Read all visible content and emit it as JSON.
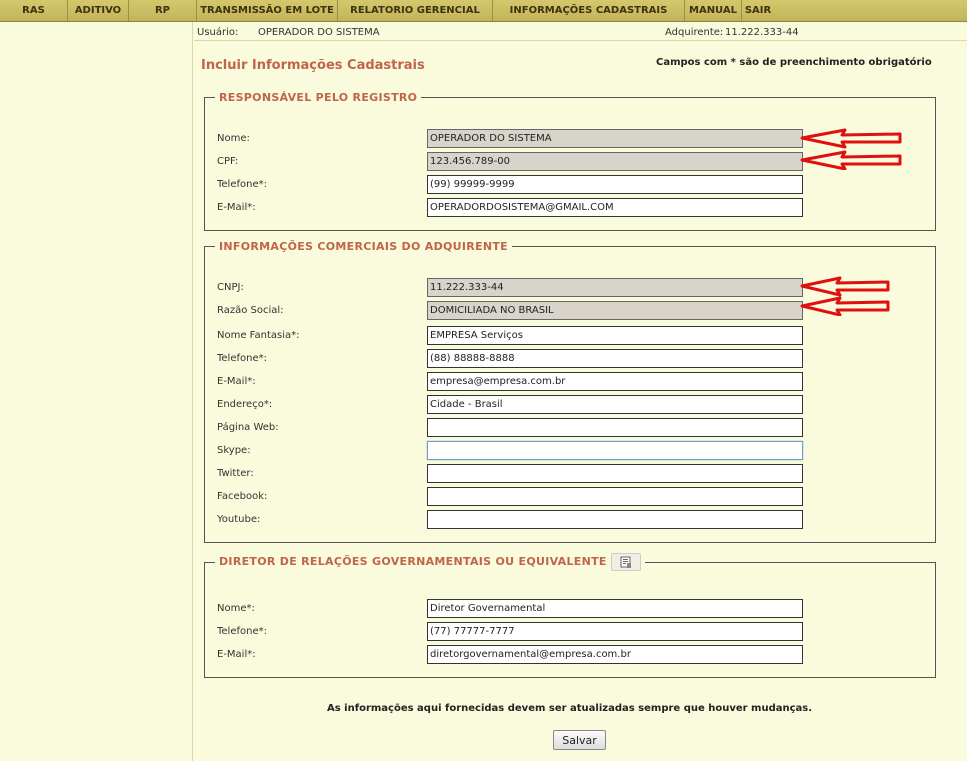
{
  "menu": [
    {
      "label": "RAS"
    },
    {
      "label": "ADITIVO"
    },
    {
      "label": "RP"
    },
    {
      "label": "TRANSMISSÃO EM LOTE"
    },
    {
      "label": "RELATORIO GERENCIAL"
    },
    {
      "label": "INFORMAÇÕES CADASTRAIS"
    },
    {
      "label": "MANUAL"
    },
    {
      "label": "SAIR"
    }
  ],
  "infobar": {
    "user_label": "Usuário:",
    "user_value": "OPERADOR DO SISTEMA",
    "acquirer_label": "Adquirente:",
    "acquirer_value": "11.222.333-44"
  },
  "page": {
    "title": "Incluir Informações Cadastrais",
    "required_note": "Campos com * são de preenchimento obrigatório",
    "footer_note": "As informações aqui fornecidas devem ser atualizadas sempre que houver mudanças.",
    "save_label": "Salvar"
  },
  "responsavel": {
    "legend": "RESPONSÁVEL PELO REGISTRO",
    "fields": [
      {
        "label": "Nome:",
        "value": "OPERADOR DO SISTEMA",
        "readonly": true
      },
      {
        "label": "CPF:",
        "value": "123.456.789-00",
        "readonly": true
      },
      {
        "label": "Telefone*:",
        "value": "(99) 99999-9999",
        "readonly": false
      },
      {
        "label": "E-Mail*:",
        "value": "OPERADORDOSISTEMA@GMAIL.COM",
        "readonly": false
      }
    ]
  },
  "comerciais": {
    "legend": "INFORMAÇÕES COMERCIAIS DO ADQUIRENTE",
    "fields": [
      {
        "label": "CNPJ:",
        "value": "11.222.333-44",
        "readonly": true
      },
      {
        "label": "Razão Social:",
        "value": "DOMICILIADA NO BRASIL",
        "readonly": true
      },
      {
        "label": "Nome Fantasia*:",
        "value": "EMPRESA Serviços",
        "readonly": false
      },
      {
        "label": "Telefone*:",
        "value": "(88) 88888-8888",
        "readonly": false
      },
      {
        "label": "E-Mail*:",
        "value": "empresa@empresa.com.br",
        "readonly": false
      },
      {
        "label": "Endereço*:",
        "value": "Cidade - Brasil",
        "readonly": false
      },
      {
        "label": "Página Web:",
        "value": "",
        "readonly": false
      },
      {
        "label": "Skype:",
        "value": "",
        "readonly": false
      },
      {
        "label": "Twitter:",
        "value": "",
        "readonly": false
      },
      {
        "label": "Facebook:",
        "value": "",
        "readonly": false
      },
      {
        "label": "Youtube:",
        "value": "",
        "readonly": false
      }
    ]
  },
  "diretor": {
    "legend": "DIRETOR DE RELAÇÕES GOVERNAMENTAIS OU EQUIVALENTE",
    "fields": [
      {
        "label": "Nome*:",
        "value": "Diretor Governamental",
        "readonly": false
      },
      {
        "label": "Telefone*:",
        "value": "(77) 77777-7777",
        "readonly": false
      },
      {
        "label": "E-Mail*:",
        "value": "diretorgovernamental@empresa.com.br",
        "readonly": false
      }
    ]
  },
  "colors": {
    "menu_bg": "#c9bb5f",
    "page_bg": "#fafadd",
    "heading": "#c0654a",
    "readonly_field": "#d8d4cc",
    "annotation_arrow": "#e01010"
  },
  "icons": {
    "copy_button": "copy-data-icon",
    "annotation": "red-arrow-icon"
  }
}
